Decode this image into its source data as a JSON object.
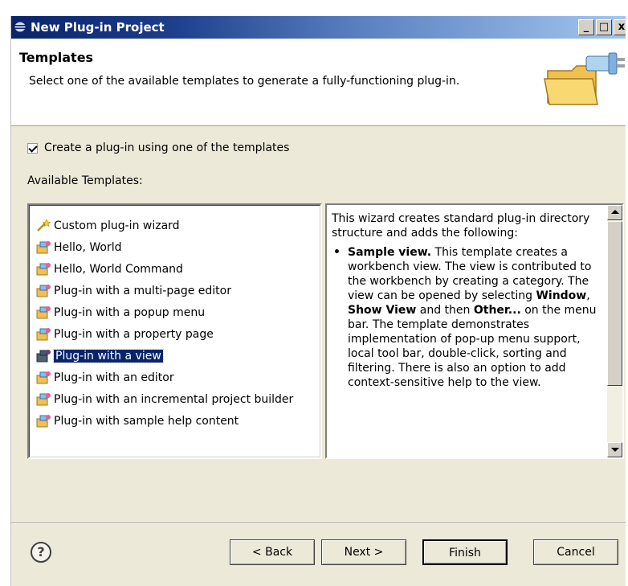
{
  "window": {
    "title": "New Plug-in Project"
  },
  "banner": {
    "title": "Templates",
    "description": "Select one of the available templates to generate a fully-functioning plug-in."
  },
  "checkbox": {
    "label": "Create a plug-in using one of the templates",
    "checked": true
  },
  "available_label": "Available Templates:",
  "templates": [
    {
      "label": "Custom plug-in wizard",
      "icon": "wizard-icon"
    },
    {
      "label": "Hello, World",
      "icon": "plugin-icon"
    },
    {
      "label": "Hello, World Command",
      "icon": "plugin-icon"
    },
    {
      "label": "Plug-in with a multi-page editor",
      "icon": "plugin-icon"
    },
    {
      "label": "Plug-in with a popup menu",
      "icon": "plugin-icon"
    },
    {
      "label": "Plug-in with a property page",
      "icon": "plugin-icon"
    },
    {
      "label": "Plug-in with a view",
      "icon": "plugin-icon",
      "selected": true
    },
    {
      "label": "Plug-in with an editor",
      "icon": "plugin-icon"
    },
    {
      "label": "Plug-in with an incremental project builder",
      "icon": "plugin-icon"
    },
    {
      "label": "Plug-in with sample help content",
      "icon": "plugin-icon"
    }
  ],
  "description": {
    "intro": "This wizard creates standard plug-in directory structure and adds the following:",
    "item_title": "Sample view.",
    "item_text_1": " This template creates a workbench view. The view is contributed to the workbench by creating a category. The view can be opened by selecting ",
    "kw_window": "Window",
    "sep1": ", ",
    "kw_show_view": "Show View",
    "sep2": " and then ",
    "kw_other": "Other...",
    "item_text_2": " on the menu bar. The template demonstrates implementation of pop-up menu support, local tool bar, double-click, sorting and filtering. There is also an option to add context-sensitive help to the view."
  },
  "buttons": {
    "back": "< Back",
    "next": "Next >",
    "finish": "Finish",
    "cancel": "Cancel"
  },
  "colors": {
    "selection": "#0a246a",
    "title_start": "#0a246a",
    "title_end": "#a6caf0"
  }
}
